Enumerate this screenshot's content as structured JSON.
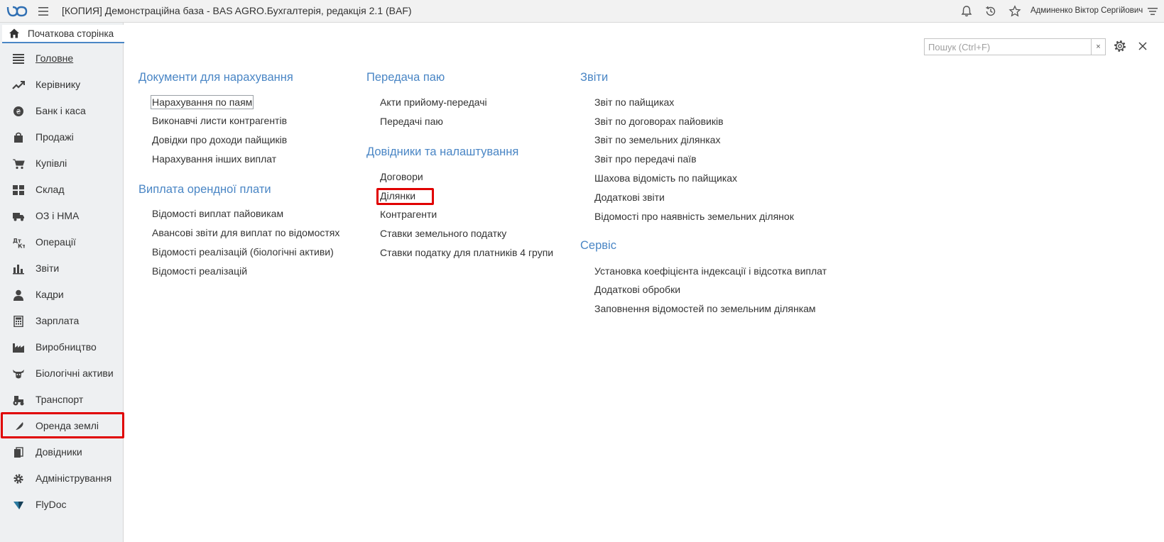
{
  "app": {
    "title": "[КОПИЯ] Демонстраційна база - BAS AGRO.Бухгалтерія, редакція 2.1  (BAF)",
    "user": "Админенко Віктор Сергійович"
  },
  "home_tab": {
    "label": "Початкова сторінка"
  },
  "sidebar": {
    "items": [
      {
        "label": "Головне",
        "icon": "list-icon"
      },
      {
        "label": "Керівнику",
        "icon": "trend-icon"
      },
      {
        "label": "Банк і каса",
        "icon": "coin-icon"
      },
      {
        "label": "Продажі",
        "icon": "bag-icon"
      },
      {
        "label": "Купівлі",
        "icon": "cart-icon"
      },
      {
        "label": "Склад",
        "icon": "warehouse-icon"
      },
      {
        "label": "ОЗ і НМА",
        "icon": "truck-icon"
      },
      {
        "label": "Операції",
        "icon": "debit-credit-icon"
      },
      {
        "label": "Звіти",
        "icon": "bar-chart-icon"
      },
      {
        "label": "Кадри",
        "icon": "person-icon"
      },
      {
        "label": "Зарплата",
        "icon": "calculator-icon"
      },
      {
        "label": "Виробництво",
        "icon": "factory-icon"
      },
      {
        "label": "Біологічні активи",
        "icon": "cow-icon"
      },
      {
        "label": "Транспорт",
        "icon": "tractor-icon"
      },
      {
        "label": "Оренда землі",
        "icon": "feather-icon"
      },
      {
        "label": "Довідники",
        "icon": "books-icon"
      },
      {
        "label": "Адміністрування",
        "icon": "gear-icon"
      },
      {
        "label": "FlyDoc",
        "icon": "flydoc-icon"
      }
    ]
  },
  "search": {
    "placeholder": "Пошук (Ctrl+F)",
    "clear": "×"
  },
  "sections": {
    "docs": {
      "title": "Документи для нарахування",
      "links": [
        "Нарахування по паям",
        "Виконавчі листи контрагентів",
        "Довідки про доходи пайщиків",
        "Нарахування інших виплат"
      ]
    },
    "rent": {
      "title": "Виплата орендної плати",
      "links": [
        "Відомості виплат пайовикам",
        "Авансові звіти для виплат по відомостях",
        "Відомості реалізацій (біологічні активи)",
        "Відомості реалізацій"
      ]
    },
    "transfer": {
      "title": "Передача паю",
      "links": [
        "Акти прийому-передачі",
        "Передачі паю"
      ]
    },
    "refs": {
      "title": "Довідники та налаштування",
      "links": [
        "Договори",
        "Ділянки",
        "Контрагенти",
        "Ставки земельного податку",
        "Ставки податку для платників 4 групи"
      ]
    },
    "reports": {
      "title": "Звіти",
      "links": [
        "Звіт по пайщиках",
        "Звіт по договорах пайовиків",
        "Звіт по земельних ділянках",
        "Звіт про передачі паїв",
        "Шахова відомість по пайщиках",
        "Додаткові звіти",
        "Відомості про наявність земельних ділянок"
      ]
    },
    "service": {
      "title": "Сервіс",
      "links": [
        "Установка коефіцієнта індексації і відсотка виплат",
        "Додаткові обробки",
        "Заповнення відомостей по земельним ділянкам"
      ]
    }
  }
}
